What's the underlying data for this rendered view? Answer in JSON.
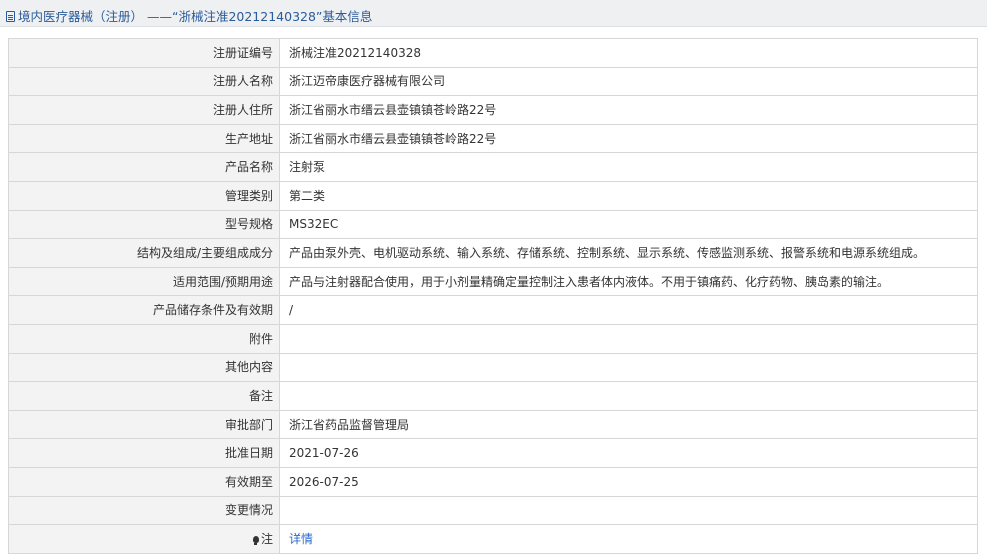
{
  "header": {
    "title": "境内医疗器械（注册） ——“浙械注准20212140328”基本信息"
  },
  "rows": [
    {
      "label": "注册证编号",
      "value": "浙械注准20212140328"
    },
    {
      "label": "注册人名称",
      "value": "浙江迈帝康医疗器械有限公司"
    },
    {
      "label": "注册人住所",
      "value": "浙江省丽水市缙云县壶镇镇苍岭路22号"
    },
    {
      "label": "生产地址",
      "value": "浙江省丽水市缙云县壶镇镇苍岭路22号"
    },
    {
      "label": "产品名称",
      "value": "注射泵"
    },
    {
      "label": "管理类别",
      "value": "第二类"
    },
    {
      "label": "型号规格",
      "value": "MS32EC"
    },
    {
      "label": "结构及组成/主要组成成分",
      "value": "产品由泵外壳、电机驱动系统、输入系统、存储系统、控制系统、显示系统、传感监测系统、报警系统和电源系统组成。"
    },
    {
      "label": "适用范围/预期用途",
      "value": "产品与注射器配合使用，用于小剂量精确定量控制注入患者体内液体。不用于镇痛药、化疗药物、胰岛素的输注。"
    },
    {
      "label": "产品储存条件及有效期",
      "value": "/"
    },
    {
      "label": "附件",
      "value": ""
    },
    {
      "label": "其他内容",
      "value": ""
    },
    {
      "label": "备注",
      "value": ""
    },
    {
      "label": "审批部门",
      "value": "浙江省药品监督管理局"
    },
    {
      "label": "批准日期",
      "value": "2021-07-26"
    },
    {
      "label": "有效期至",
      "value": "2026-07-25"
    },
    {
      "label": "变更情况",
      "value": ""
    }
  ],
  "note_row": {
    "label": "注",
    "icon": "bulb-icon",
    "link_text": "详情"
  },
  "colors": {
    "title_text": "#2a5b9a",
    "label_bg": "#f3f3f3",
    "border": "#d7d7d7",
    "link": "#2a6acb"
  }
}
